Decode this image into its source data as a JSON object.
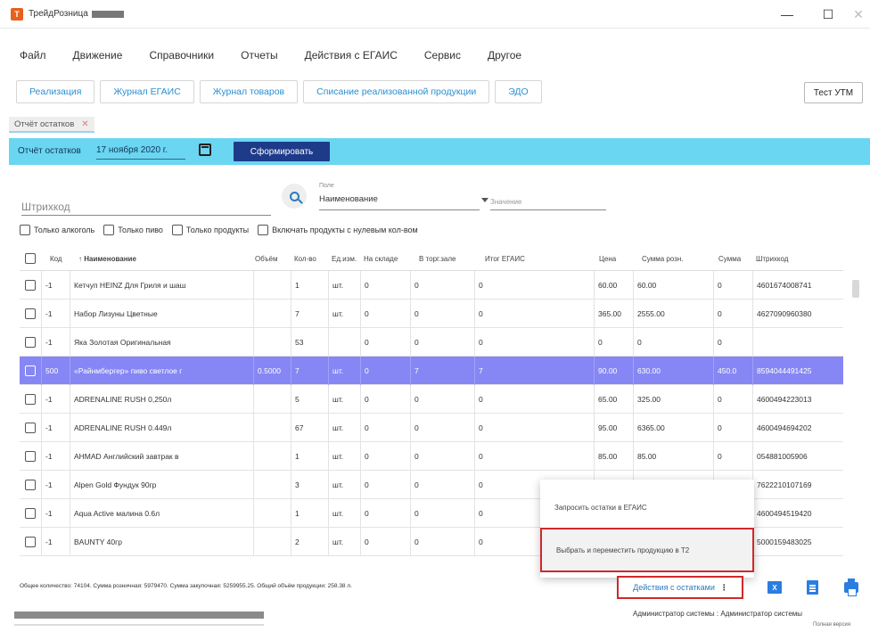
{
  "window": {
    "title": "ТрейдРозница",
    "minimize": "—",
    "maximize": "☐",
    "close": "✕"
  },
  "menu": [
    "Файл",
    "Движение",
    "Справочники",
    "Отчеты",
    "Действия с ЕГАИС",
    "Сервис",
    "Другое"
  ],
  "quick_tabs": [
    "Реализация",
    "Журнал ЕГАИС",
    "Журнал товаров",
    "Списание реализованной продукции",
    "ЭДО"
  ],
  "utm_button": "Тест УТМ",
  "document_tab": {
    "label": "Отчёт остатков",
    "close": "✕"
  },
  "report_bar": {
    "label": "Отчёт остатков",
    "date": "17 ноября 2020 г.",
    "generate_label": "Сформировать"
  },
  "search": {
    "placeholder": "Штрихкод",
    "field_caption": "Поле",
    "field_value": "Наименование",
    "value_placeholder": "Значение"
  },
  "filters": [
    "Только алкоголь",
    "Только пиво",
    "Только продукты",
    "Включать продукты с нулевым кол-вом"
  ],
  "table": {
    "columns": [
      "Код",
      "↑ Наименование",
      "Объём",
      "Кол-во",
      "Ед.изм.",
      "На складе",
      "В торг.зале",
      "Итог ЕГАИС",
      "Цена",
      "Сумма розн.",
      "Сумма",
      "Штрихкод"
    ],
    "rows": [
      {
        "code": "-1",
        "name": "Кетчуп HEINZ Для Гриля и шаш",
        "volume": "",
        "qty": "1",
        "unit": "шт.",
        "stock": "0",
        "hall": "0",
        "egais": "0",
        "price": "60.00",
        "sum_retail": "60.00",
        "sum": "0",
        "barcode": "4601674008741",
        "selected": false
      },
      {
        "code": "-1",
        "name": "Набор Лизуны Цветные",
        "volume": "",
        "qty": "7",
        "unit": "шт.",
        "stock": "0",
        "hall": "0",
        "egais": "0",
        "price": "365.00",
        "sum_retail": "2555.00",
        "sum": "0",
        "barcode": "4627090960380",
        "selected": false
      },
      {
        "code": "-1",
        "name": "Яка Золотая Оригинальная",
        "volume": "",
        "qty": "53",
        "unit": "",
        "stock": "0",
        "hall": "0",
        "egais": "0",
        "price": "0",
        "sum_retail": "0",
        "sum": "0",
        "barcode": "",
        "selected": false
      },
      {
        "code": "500",
        "name": "«Райнмбергер» пиво светлое г",
        "volume": "0.5000",
        "qty": "7",
        "unit": "шт.",
        "stock": "0",
        "hall": "7",
        "egais": "7",
        "price": "90.00",
        "sum_retail": "630.00",
        "sum": "450.0",
        "barcode": "8594044491425",
        "selected": true
      },
      {
        "code": "-1",
        "name": "ADRENALINE RUSH 0,250л",
        "volume": "",
        "qty": "5",
        "unit": "шт.",
        "stock": "0",
        "hall": "0",
        "egais": "0",
        "price": "65.00",
        "sum_retail": "325.00",
        "sum": "0",
        "barcode": "4600494223013",
        "selected": false
      },
      {
        "code": "-1",
        "name": "ADRENALINE RUSH 0.449л",
        "volume": "",
        "qty": "67",
        "unit": "шт.",
        "stock": "0",
        "hall": "0",
        "egais": "0",
        "price": "95.00",
        "sum_retail": "6365.00",
        "sum": "0",
        "barcode": "4600494694202",
        "selected": false
      },
      {
        "code": "-1",
        "name": "AHMAD Английский завтрак в",
        "volume": "",
        "qty": "1",
        "unit": "шт.",
        "stock": "0",
        "hall": "0",
        "egais": "0",
        "price": "85.00",
        "sum_retail": "85.00",
        "sum": "0",
        "barcode": "054881005906",
        "selected": false
      },
      {
        "code": "-1",
        "name": "Alpen Gold Фундук 90гр",
        "volume": "",
        "qty": "3",
        "unit": "шт.",
        "stock": "0",
        "hall": "0",
        "egais": "0",
        "price": "",
        "sum_retail": "",
        "sum": "",
        "barcode": "7622210107169",
        "selected": false
      },
      {
        "code": "-1",
        "name": "Aqua Active малина 0.6л",
        "volume": "",
        "qty": "1",
        "unit": "шт.",
        "stock": "0",
        "hall": "0",
        "egais": "0",
        "price": "",
        "sum_retail": "",
        "sum": "",
        "barcode": "4600494519420",
        "selected": false
      },
      {
        "code": "-1",
        "name": "BAUNTY 40гр",
        "volume": "",
        "qty": "2",
        "unit": "шт.",
        "stock": "0",
        "hall": "0",
        "egais": "0",
        "price": "",
        "sum_retail": "",
        "sum": "",
        "barcode": "5000159483025",
        "selected": false
      }
    ]
  },
  "footer": {
    "summary": "Общее количество: 74104. Сумма розничная: 5979470. Сумма закупочная: 5259955.25. Общий объём продукции: 258.38 л.",
    "actions_label": "Действия с остатками",
    "actions_dots": "⋮"
  },
  "popup": {
    "items": [
      "Запросить остатки в ЕГАИС",
      "Выбрать и переместить продукцию в Т2"
    ]
  },
  "status": {
    "user": "Администратор системы : Администратор системы",
    "version": "Полная версия"
  },
  "colors": {
    "report_bar": "#6ad6f1",
    "generate_button": "#1e3b8a",
    "selected_row": "#8687f4",
    "highlight_border": "#d0282a",
    "link_blue": "#2a8fd0"
  }
}
